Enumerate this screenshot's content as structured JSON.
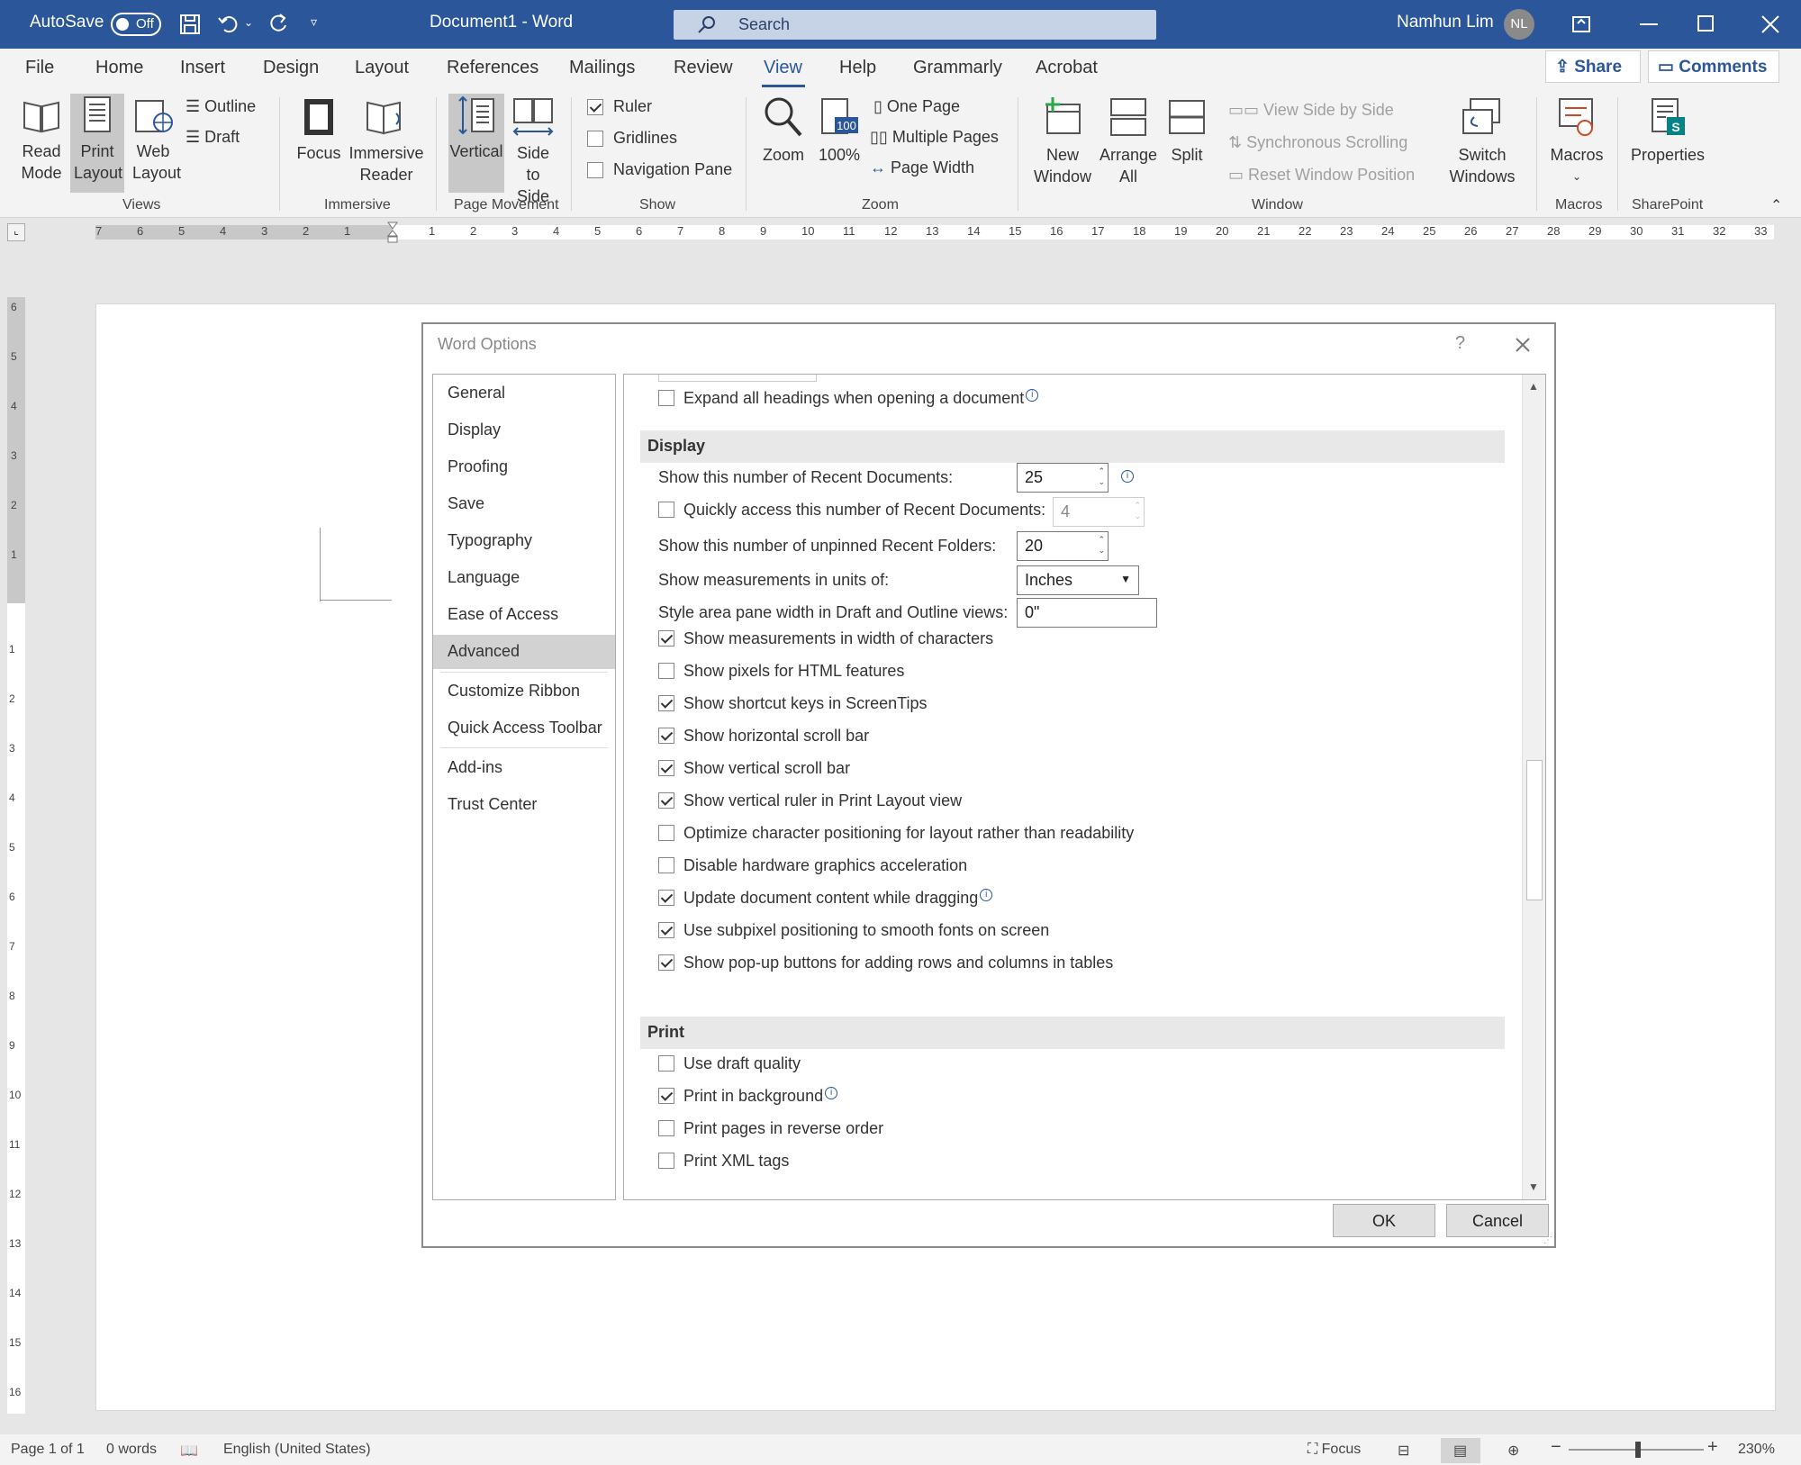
{
  "titlebar": {
    "autosave_label": "AutoSave",
    "autosave_state": "Off",
    "document_title": "Document1  -  Word",
    "search_placeholder": "Search",
    "user_name": "Namhun Lim",
    "user_initials": "NL"
  },
  "menu": {
    "tabs": [
      "File",
      "Home",
      "Insert",
      "Design",
      "Layout",
      "References",
      "Mailings",
      "Review",
      "View",
      "Help",
      "Grammarly",
      "Acrobat"
    ],
    "active_tab": "View",
    "share_label": "Share",
    "comments_label": "Comments"
  },
  "ribbon": {
    "views": {
      "read_mode": "Read Mode",
      "print_layout": "Print Layout",
      "web_layout": "Web Layout",
      "outline": "Outline",
      "draft": "Draft",
      "group": "Views"
    },
    "immersive": {
      "focus": "Focus",
      "reader": "Immersive Reader",
      "group": "Immersive"
    },
    "page_movement": {
      "vertical": "Vertical",
      "side": "Side to Side",
      "group": "Page Movement"
    },
    "show": {
      "ruler": "Ruler",
      "gridlines": "Gridlines",
      "navigation": "Navigation Pane",
      "group": "Show",
      "ruler_checked": true,
      "gridlines_checked": false,
      "navigation_checked": false
    },
    "zoom": {
      "zoom": "Zoom",
      "hundred": "100%",
      "one_page": "One Page",
      "multiple": "Multiple Pages",
      "width": "Page Width",
      "group": "Zoom",
      "icon_text": "100"
    },
    "window": {
      "new": "New Window",
      "arrange": "Arrange All",
      "split": "Split",
      "side_by_side": "View Side by Side",
      "sync": "Synchronous Scrolling",
      "reset": "Reset Window Position",
      "switch": "Switch Windows",
      "group": "Window"
    },
    "macros": {
      "label": "Macros",
      "group": "Macros"
    },
    "sharepoint": {
      "label": "Properties",
      "group": "SharePoint"
    }
  },
  "hruler": {
    "left_nums": [
      "7",
      "6",
      "5",
      "4",
      "3",
      "2",
      "1"
    ],
    "right_nums": [
      "1",
      "2",
      "3",
      "4",
      "5",
      "6",
      "7",
      "8",
      "9",
      "10",
      "11",
      "12",
      "13",
      "14",
      "15",
      "16",
      "17",
      "18",
      "19",
      "20",
      "21",
      "22",
      "23",
      "24",
      "25",
      "26",
      "27",
      "28",
      "29",
      "30",
      "31",
      "32",
      "33"
    ]
  },
  "vruler": {
    "top_nums": [
      "6",
      "5",
      "4",
      "3",
      "2",
      "1"
    ],
    "bottom_nums": [
      "1",
      "2",
      "3",
      "4",
      "5",
      "6",
      "7",
      "8",
      "9",
      "10",
      "11",
      "12",
      "13",
      "14",
      "15",
      "16"
    ]
  },
  "dialog": {
    "title": "Word Options",
    "help": "?",
    "nav": [
      "General",
      "Display",
      "Proofing",
      "Save",
      "Typography",
      "Language",
      "Ease of Access",
      "Advanced",
      "Customize Ribbon",
      "Quick Access Toolbar",
      "Add-ins",
      "Trust Center"
    ],
    "selected_nav": "Advanced",
    "expand_headings": "Expand all headings when opening a document",
    "display_header": "Display",
    "recent_docs_label": "Show this number of Recent Documents:",
    "recent_docs_value": "25",
    "quick_access_label": "Quickly access this number of Recent Documents:",
    "quick_access_value": "4",
    "recent_folders_label": "Show this number of unpinned Recent Folders:",
    "recent_folders_value": "20",
    "units_label": "Show measurements in units of:",
    "units_value": "Inches",
    "style_area_label": "Style area pane width in Draft and Outline views:",
    "style_area_value": "0\"",
    "display_options": [
      {
        "label": "Show measurements in width of characters",
        "checked": true
      },
      {
        "label": "Show pixels for HTML features",
        "checked": false
      },
      {
        "label": "Show shortcut keys in ScreenTips",
        "checked": true
      },
      {
        "label": "Show horizontal scroll bar",
        "checked": true
      },
      {
        "label": "Show vertical scroll bar",
        "checked": true
      },
      {
        "label": "Show vertical ruler in Print Layout view",
        "checked": true
      },
      {
        "label": "Optimize character positioning for layout rather than readability",
        "checked": false
      },
      {
        "label": "Disable hardware graphics acceleration",
        "checked": false
      },
      {
        "label": "Update document content while dragging",
        "checked": true
      },
      {
        "label": "Use subpixel positioning to smooth fonts on screen",
        "checked": true
      },
      {
        "label": "Show pop-up buttons for adding rows and columns in tables",
        "checked": true
      }
    ],
    "print_header": "Print",
    "print_options": [
      {
        "label": "Use draft quality",
        "checked": false
      },
      {
        "label": "Print in background",
        "checked": true
      },
      {
        "label": "Print pages in reverse order",
        "checked": false
      },
      {
        "label": "Print XML tags",
        "checked": false
      }
    ],
    "ok": "OK",
    "cancel": "Cancel"
  },
  "status": {
    "page": "Page 1 of 1",
    "words": "0 words",
    "language": "English (United States)",
    "focus": "Focus",
    "zoom": "230%"
  },
  "colors": {
    "accent": "#2b579a",
    "ribbon_bg": "#f3f3f3",
    "selected": "#c8c8c8"
  }
}
